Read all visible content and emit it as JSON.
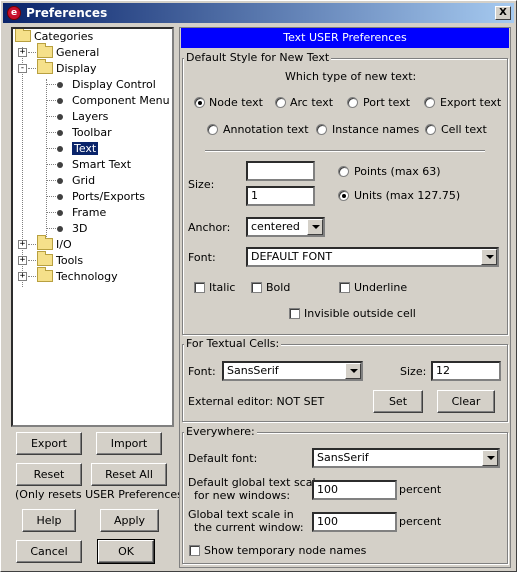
{
  "window": {
    "title": "Preferences",
    "close_label": "X"
  },
  "tree": {
    "root": "Categories",
    "items": [
      {
        "label": "General"
      },
      {
        "label": "Display"
      },
      {
        "label": "Display Control"
      },
      {
        "label": "Component Menu"
      },
      {
        "label": "Layers"
      },
      {
        "label": "Toolbar"
      },
      {
        "label": "Text"
      },
      {
        "label": "Smart Text"
      },
      {
        "label": "Grid"
      },
      {
        "label": "Ports/Exports"
      },
      {
        "label": "Frame"
      },
      {
        "label": "3D"
      },
      {
        "label": "I/O"
      },
      {
        "label": "Tools"
      },
      {
        "label": "Technology"
      }
    ],
    "selected": "Text"
  },
  "left_buttons": {
    "export": "Export",
    "import": "Import",
    "reset": "Reset",
    "reset_all": "Reset All",
    "reset_note": "(Only resets USER Preferences)",
    "help": "Help",
    "apply": "Apply",
    "cancel": "Cancel",
    "ok": "OK"
  },
  "panel": {
    "header": "Text USER Preferences",
    "default_style": {
      "group_label": "Default Style for New Text",
      "which_type_label": "Which type of new text:",
      "text_types": [
        "Node text",
        "Arc text",
        "Port text",
        "Export text",
        "Annotation text",
        "Instance names",
        "Cell text"
      ],
      "selected_type": "Node text",
      "size_label": "Size:",
      "points_value": "",
      "units_value": "1",
      "points_label": "Points (max 63)",
      "units_label": "Units (max 127.75)",
      "size_mode": "Units",
      "anchor_label": "Anchor:",
      "anchor_value": "centered",
      "font_label": "Font:",
      "font_value": "DEFAULT FONT",
      "italic_label": "Italic",
      "bold_label": "Bold",
      "underline_label": "Underline",
      "invisible_label": "Invisible outside cell"
    },
    "textual_cells": {
      "group_label": "For Textual Cells:",
      "font_label": "Font:",
      "font_value": "SansSerif",
      "size_label": "Size:",
      "size_value": "12",
      "external_editor_label": "External editor: NOT SET",
      "set_label": "Set",
      "clear_label": "Clear"
    },
    "everywhere": {
      "group_label": "Everywhere:",
      "default_font_label": "Default font:",
      "default_font_value": "SansSerif",
      "global_scale_label_1": "Default global text scale",
      "global_scale_label_2": "for new windows:",
      "global_scale_value": "100",
      "global_scale_unit": "percent",
      "window_scale_label_1": "Global text scale in",
      "window_scale_label_2": "the current window:",
      "window_scale_value": "100",
      "window_scale_unit": "percent",
      "temp_names_label": "Show temporary node names"
    }
  }
}
